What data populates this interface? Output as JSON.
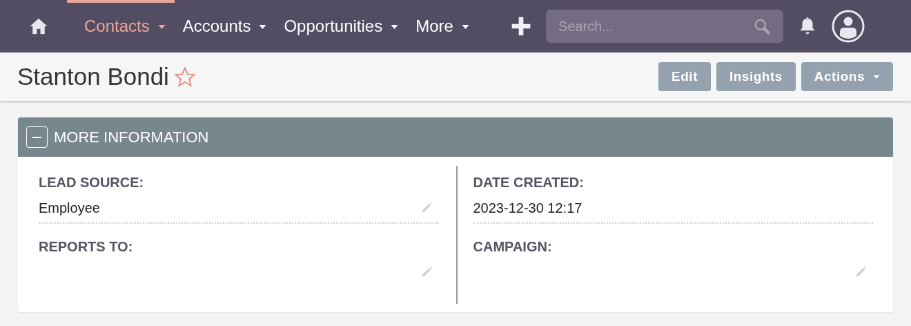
{
  "nav": {
    "items": [
      {
        "label": "Contacts",
        "selected": true
      },
      {
        "label": "Accounts",
        "selected": false
      },
      {
        "label": "Opportunities",
        "selected": false
      },
      {
        "label": "More",
        "selected": false
      }
    ],
    "search": {
      "placeholder": "Search..."
    }
  },
  "record": {
    "title": "Stanton Bondi",
    "favorite": false,
    "buttons": [
      {
        "label": "Edit",
        "dropdown": false
      },
      {
        "label": "Insights",
        "dropdown": false
      },
      {
        "label": "Actions",
        "dropdown": true
      }
    ]
  },
  "panel": {
    "title": "MORE INFORMATION",
    "expanded": true,
    "columns": [
      {
        "fields": [
          {
            "label": "LEAD SOURCE:",
            "value": "Employee",
            "editable": true
          },
          {
            "label": "REPORTS TO:",
            "editable": true
          }
        ]
      },
      {
        "fields": [
          {
            "label": "DATE CREATED:",
            "value": "2023-12-30 12:17",
            "editable": false
          },
          {
            "label": "CAMPAIGN:",
            "editable": true
          }
        ]
      }
    ]
  }
}
